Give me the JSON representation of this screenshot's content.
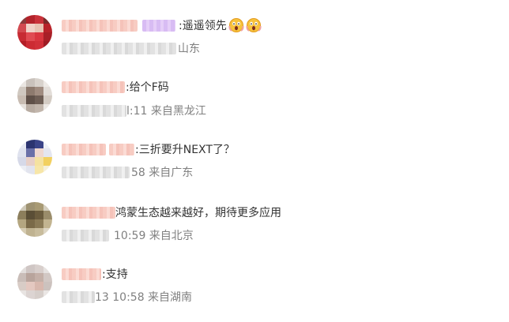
{
  "comments": [
    {
      "text": ":遥遥领先",
      "meta": "山东",
      "emojis": [
        "scream-emoji",
        "scream-emoji"
      ]
    },
    {
      "text": ":给个F码",
      "meta": "l:11 来自黑龙江"
    },
    {
      "text": ":三折要升NEXT了？",
      "meta": "58 来自广东"
    },
    {
      "text": "鸿蒙生态越来越好，期待更多应用",
      "meta": "10:59 来自北京"
    },
    {
      "text": ":支持",
      "meta": "13 10:58 来自湖南"
    }
  ]
}
